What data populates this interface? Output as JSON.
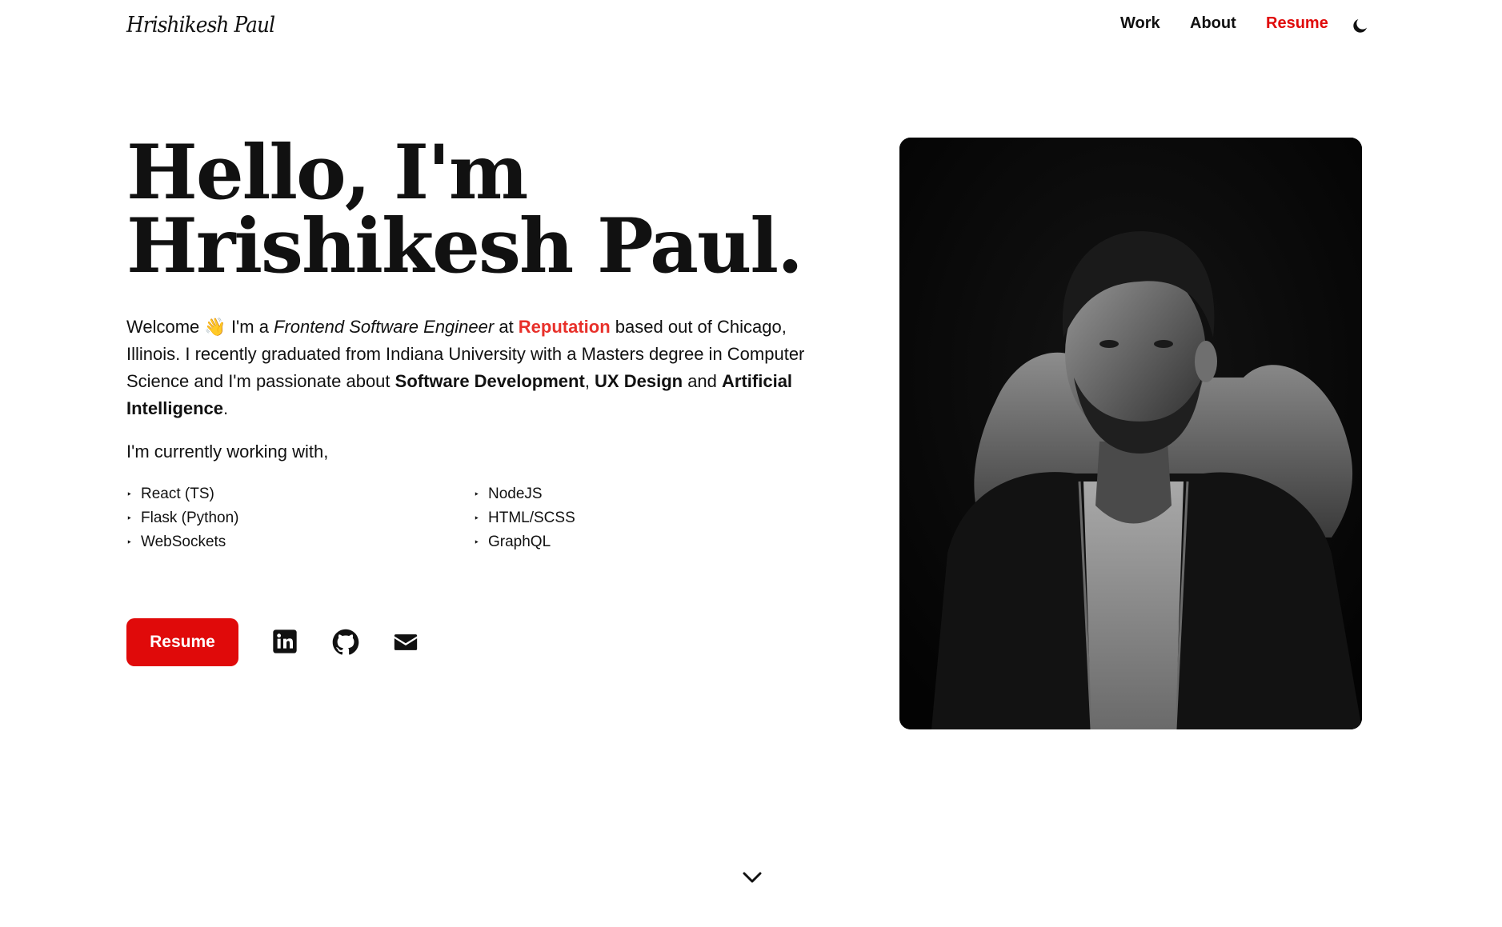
{
  "header": {
    "logo_text": "Hrishikesh Paul",
    "nav": {
      "work": "Work",
      "about": "About",
      "resume": "Resume"
    },
    "theme_toggle_icon": "moon-icon"
  },
  "hero": {
    "title_line1": "Hello, I'm",
    "title_line2": "Hrishikesh Paul.",
    "intro": {
      "welcome": "Welcome",
      "wave_emoji": "👋",
      "im_a": " I'm a ",
      "role": "Frontend Software Engineer",
      "at": " at ",
      "employer": "Reputation",
      "location_text": " based out of Chicago, Illinois. I recently graduated from Indiana University with a Masters degree in Computer Science and I'm passionate about ",
      "interest1": "Software Development",
      "sep1": ", ",
      "interest2": "UX Design",
      "sep2": " and ",
      "interest3": "Artificial Intelligence",
      "end": "."
    },
    "working_with": "I'm currently working with,",
    "tech": [
      "React (TS)",
      "Flask (Python)",
      "WebSockets",
      "NodeJS",
      "HTML/SCSS",
      "GraphQL"
    ],
    "bullet": "‣",
    "resume_button": "Resume",
    "social_icons": [
      "linkedin-icon",
      "github-icon",
      "email-icon"
    ]
  },
  "colors": {
    "accent": "#e00a0a",
    "employer_link": "#e8302a",
    "text": "#111111",
    "background": "#ffffff"
  },
  "scroll_icon": "chevron-down-icon"
}
